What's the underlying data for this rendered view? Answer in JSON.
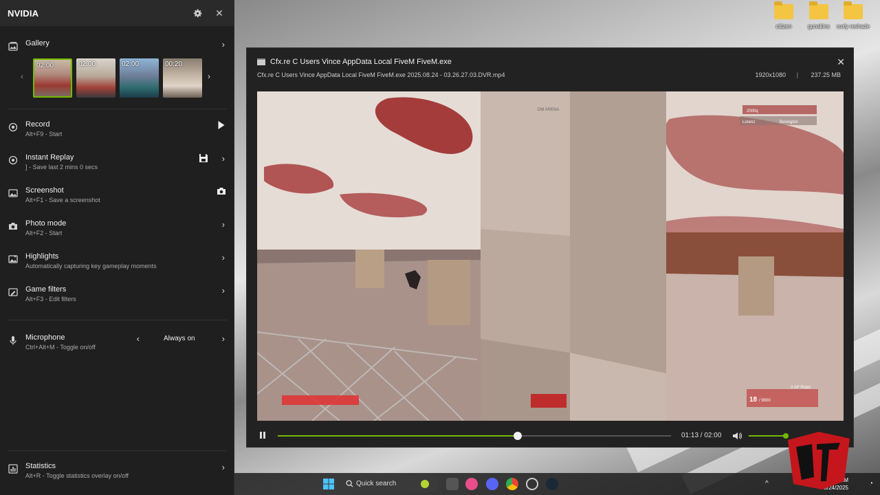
{
  "desktop": {
    "icons": [
      {
        "label": "citizen"
      },
      {
        "label": "gunskins"
      },
      {
        "label": "curly reshade"
      }
    ]
  },
  "sidebar": {
    "brand": "NVIDIA",
    "gallery": {
      "title": "Gallery",
      "thumbnails": [
        {
          "duration": "02:00",
          "selected": true
        },
        {
          "duration": "02:00",
          "selected": false
        },
        {
          "duration": "02:00",
          "selected": false
        },
        {
          "duration": "00:20",
          "selected": false
        }
      ]
    },
    "record": {
      "title": "Record",
      "subtitle": "Alt+F9 - Start"
    },
    "instant_replay": {
      "title": "Instant Replay",
      "subtitle": "] - Save last 2 mins 0 secs"
    },
    "screenshot": {
      "title": "Screenshot",
      "subtitle": "Alt+F1 - Save a screenshot"
    },
    "photo_mode": {
      "title": "Photo mode",
      "subtitle": "Alt+F2 - Start"
    },
    "highlights": {
      "title": "Highlights",
      "subtitle": "Automatically capturing key gameplay moments"
    },
    "game_filters": {
      "title": "Game filters",
      "subtitle": "Alt+F3 - Edit filters"
    },
    "microphone": {
      "title": "Microphone",
      "subtitle": "Ctrl+Alt+M - Toggle on/off",
      "mode": "Always on"
    },
    "statistics": {
      "title": "Statistics",
      "subtitle": "Alt+R - Toggle statistics overlay on/off"
    }
  },
  "player": {
    "title": "Cfx.re C Users Vince AppData Local FiveM FiveM.exe",
    "filename": "Cfx.re C Users Vince AppData Local FiveM FiveM.exe 2025.08.24 - 03.26.27.03.DVR.mp4",
    "resolution": "1920x1080",
    "separator": "|",
    "size": "237.25 MB",
    "time": "01:13 / 02:00",
    "progress": 0.61,
    "volume": 1.0,
    "hud": {
      "location": "DM ARENA",
      "kill1": "2000q",
      "kill2": "Lorenz",
      "kill2b": "Bovington",
      "weapon": "// AP Pistol",
      "ammo": "18",
      "reserve": "/ 9900"
    }
  },
  "taskbar": {
    "search_placeholder": "Quick search",
    "time": "3:59 AM",
    "date": "8/24/2025"
  },
  "colors": {
    "accent": "#76b900",
    "sidebar_bg": "#1f1f1f",
    "header_bg": "#2a2a2a"
  }
}
